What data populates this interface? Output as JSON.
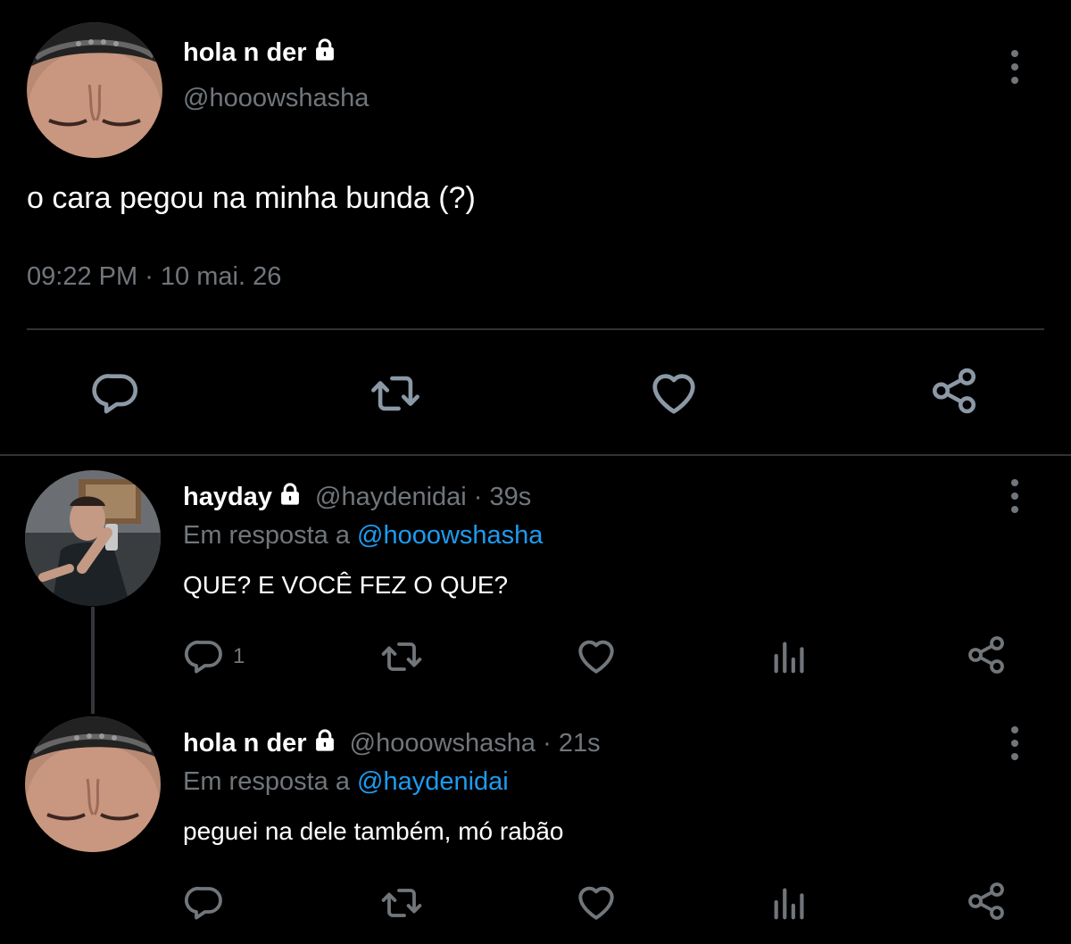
{
  "main_tweet": {
    "display_name": "hola n der",
    "handle": "@hooowshasha",
    "text": "o cara pegou na minha bunda (?)",
    "time": "09:22 PM",
    "separator": " · ",
    "date": "10 mai. 26",
    "actions": [
      "reply-icon",
      "retweet-icon",
      "like-icon",
      "share-icon"
    ]
  },
  "replies": [
    {
      "display_name": "hayday",
      "handle": "@haydenidai",
      "age": "39s",
      "separator": " · ",
      "reply_prefix": "Em resposta a ",
      "reply_to": "@hooowshasha",
      "text": "QUE? E VOCÊ FEZ O QUE?",
      "reply_count": "1",
      "actions": [
        "reply-icon",
        "retweet-icon",
        "like-icon",
        "analytics-icon",
        "share-icon"
      ]
    },
    {
      "display_name": "hola n der",
      "handle": "@hooowshasha",
      "age": "21s",
      "separator": " · ",
      "reply_prefix": "Em resposta a ",
      "reply_to": "@haydenidai",
      "text": "peguei na dele também, mó rabão",
      "reply_count": "",
      "actions": [
        "reply-icon",
        "retweet-icon",
        "like-icon",
        "analytics-icon",
        "share-icon"
      ]
    }
  ],
  "colors": {
    "background": "#000000",
    "text": "#e7e9ea",
    "muted": "#71767b",
    "link": "#1d9bf0",
    "divider": "#2f3336"
  }
}
